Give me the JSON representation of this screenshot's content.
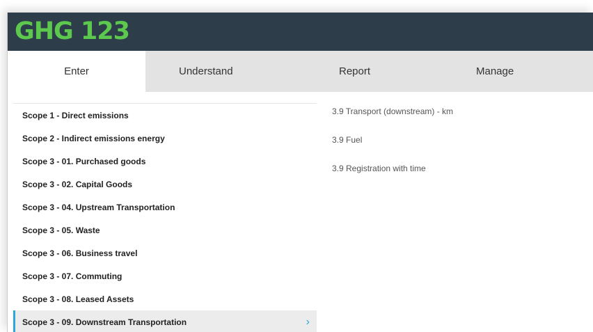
{
  "app": {
    "logo": "GHG 123"
  },
  "nav": {
    "tabs": [
      "Enter",
      "Understand",
      "Report",
      "Manage"
    ],
    "active_tab": "Enter"
  },
  "scopes": [
    "Scope 1 - Direct emissions",
    "Scope 2 - Indirect emissions energy",
    "Scope 3 - 01. Purchased goods",
    "Scope 3 - 02. Capital Goods",
    "Scope 3 - 04. Upstream Transportation",
    "Scope 3 - 05. Waste",
    "Scope 3 - 06. Business travel",
    "Scope 3 - 07. Commuting",
    "Scope 3 - 08. Leased Assets",
    "Scope 3 - 09. Downstream Transportation"
  ],
  "selected_scope": "Scope 3 - 09. Downstream Transportation",
  "selected_chevron": "›",
  "subitems": [
    "3.9 Transport (downstream) - km",
    "3.9 Fuel",
    "3.9 Registration with time"
  ],
  "colors": {
    "header_bg": "#2d3d4a",
    "logo": "#5dc84e",
    "tab_bar_bg": "#e3e3e3",
    "accent": "#2aa8d8",
    "selected_row_bg": "#ececec"
  },
  "icons": {
    "selected_row": "chevron-right-icon"
  }
}
